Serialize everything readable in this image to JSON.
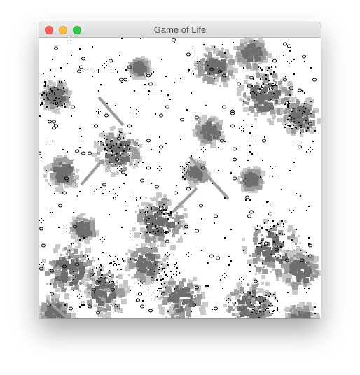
{
  "window": {
    "title": "Game of Life",
    "buttons": {
      "close": "close-icon",
      "minimize": "minimize-icon",
      "zoom": "zoom-icon"
    }
  },
  "grid": {
    "cell_colors": {
      "live": "#000000",
      "trail_dark": "#6f6f6f",
      "trail_mid": "#9c9c9c",
      "trail_light": "#c8c8c8",
      "background": "#ffffff"
    }
  }
}
